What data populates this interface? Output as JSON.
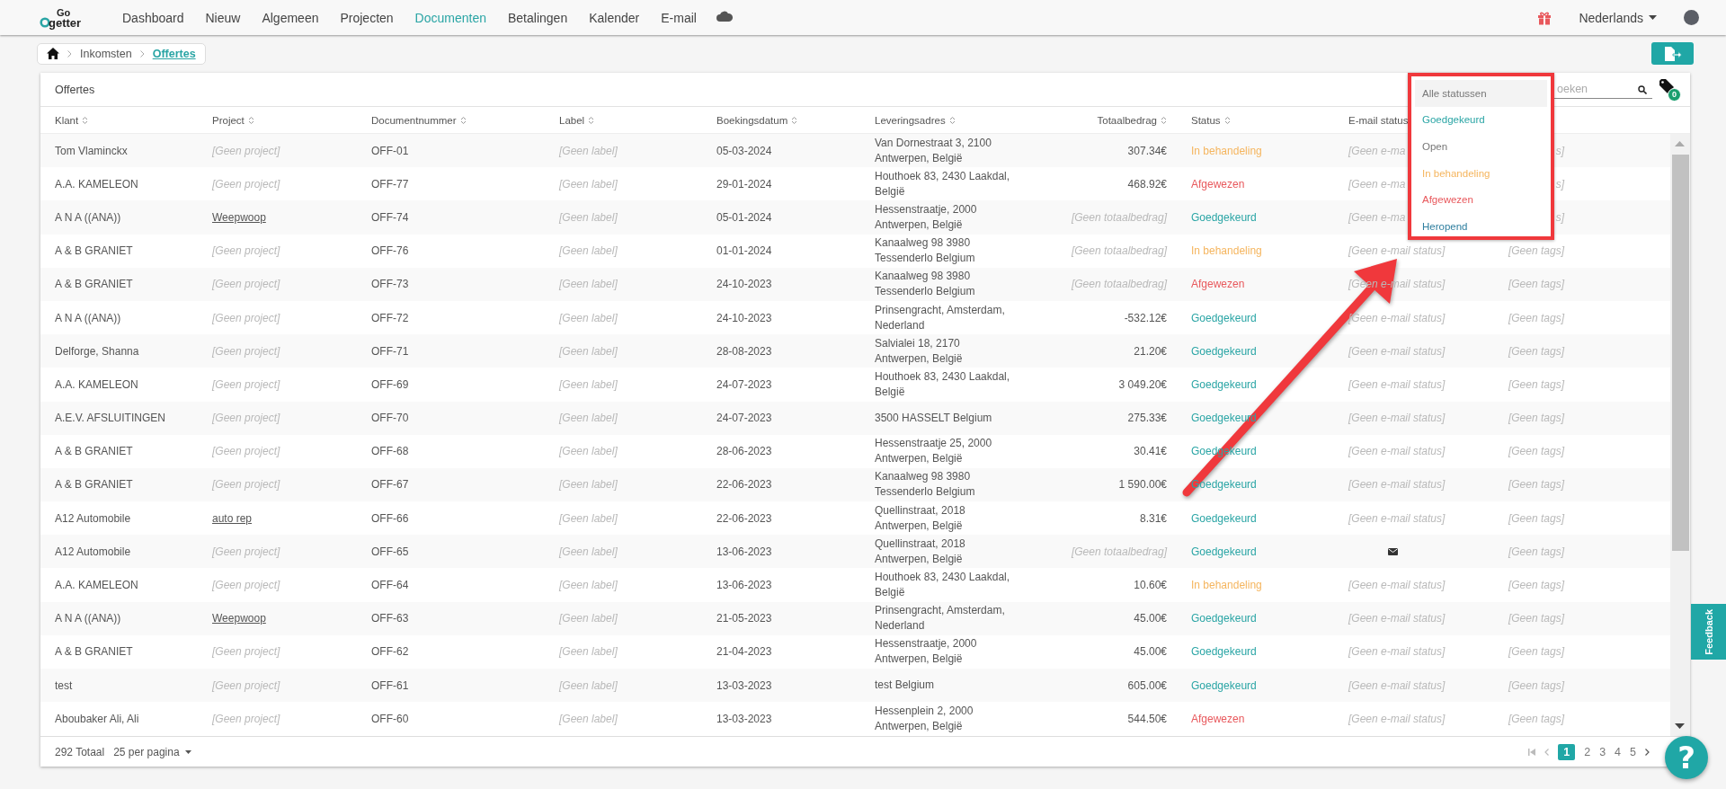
{
  "nav": {
    "logo": {
      "line_1": "Go",
      "line_2": "getter"
    },
    "items": [
      {
        "label": "Dashboard",
        "selected": false
      },
      {
        "label": "Nieuw",
        "selected": false
      },
      {
        "label": "Algemeen",
        "selected": false
      },
      {
        "label": "Projecten",
        "selected": false
      },
      {
        "label": "Documenten",
        "selected": true
      },
      {
        "label": "Betalingen",
        "selected": false
      },
      {
        "label": "Kalender",
        "selected": false
      },
      {
        "label": "E-mail",
        "selected": false
      }
    ],
    "language": "Nederlands"
  },
  "breadcrumb": [
    {
      "label": "Inkomsten",
      "selected": false
    },
    {
      "label": "Offertes",
      "selected": true
    }
  ],
  "card": {
    "title": "Offertes",
    "search": {
      "placeholder": "oeken"
    },
    "tag_count": "0"
  },
  "table": {
    "columns": [
      "Klant",
      "Project",
      "Documentnummer",
      "Label",
      "Boekingsdatum",
      "Leveringsadres",
      "Totaalbedrag",
      "Status",
      "E-mail status"
    ],
    "rows": [
      {
        "client": "Tom Vlaminckx",
        "project": {
          "text": "[Geen project]",
          "kind": "placeholder"
        },
        "number": "OFF-01",
        "label": {
          "text": "[Geen label]",
          "kind": "placeholder"
        },
        "date": "05-03-2024",
        "address": "Van Dornestraat 3, 2100\nAntwerpen, België",
        "amount": {
          "text": "307.34€",
          "kind": "value"
        },
        "status": {
          "text": "In behandeling",
          "color": "#f5b55e"
        },
        "email_status": {
          "text": "[Geen e-ma",
          "kind": "placeholder"
        },
        "tags": {
          "text": "s]",
          "kind": "placeholder"
        }
      },
      {
        "client": "A.A. KAMELEON",
        "project": {
          "text": "[Geen project]",
          "kind": "placeholder"
        },
        "number": "OFF-77",
        "label": {
          "text": "[Geen label]",
          "kind": "placeholder"
        },
        "date": "29-01-2024",
        "address": "Houthoek 83, 2430 Laakdal,\nBelgië",
        "amount": {
          "text": "468.92€",
          "kind": "value"
        },
        "status": {
          "text": "Afgewezen",
          "color": "#e8585c"
        },
        "email_status": {
          "text": "[Geen e-ma",
          "kind": "placeholder"
        },
        "tags": {
          "text": "s]",
          "kind": "placeholder"
        }
      },
      {
        "client": "A N A ((ANA))",
        "project": {
          "text": "Weepwoop",
          "kind": "link"
        },
        "number": "OFF-74",
        "label": {
          "text": "[Geen label]",
          "kind": "placeholder"
        },
        "date": "05-01-2024",
        "address": "Hessenstraatje, 2000\nAntwerpen, België",
        "amount": {
          "text": "[Geen totaalbedrag]",
          "kind": "placeholder"
        },
        "status": {
          "text": "Goedgekeurd",
          "color": "#2aa5a5"
        },
        "email_status": {
          "text": "[Geen e-ma",
          "kind": "placeholder"
        },
        "tags": {
          "text": "s]",
          "kind": "placeholder"
        }
      },
      {
        "client": "A & B GRANIET",
        "project": {
          "text": "[Geen project]",
          "kind": "placeholder"
        },
        "number": "OFF-76",
        "label": {
          "text": "[Geen label]",
          "kind": "placeholder"
        },
        "date": "01-01-2024",
        "address": "Kanaalweg 98 3980\nTessenderlo Belgium",
        "amount": {
          "text": "[Geen totaalbedrag]",
          "kind": "placeholder"
        },
        "status": {
          "text": "In behandeling",
          "color": "#f5b55e"
        },
        "email_status": {
          "text": "[Geen e-mail status]",
          "kind": "placeholder"
        },
        "tags": {
          "text": "[Geen tags]",
          "kind": "placeholder"
        }
      },
      {
        "client": "A & B GRANIET",
        "project": {
          "text": "[Geen project]",
          "kind": "placeholder"
        },
        "number": "OFF-73",
        "label": {
          "text": "[Geen label]",
          "kind": "placeholder"
        },
        "date": "24-10-2023",
        "address": "Kanaalweg 98 3980\nTessenderlo Belgium",
        "amount": {
          "text": "[Geen totaalbedrag]",
          "kind": "placeholder"
        },
        "status": {
          "text": "Afgewezen",
          "color": "#e8585c"
        },
        "email_status": {
          "text": "[Geen e-mail status]",
          "kind": "placeholder"
        },
        "tags": {
          "text": "[Geen tags]",
          "kind": "placeholder"
        }
      },
      {
        "client": "A N A ((ANA))",
        "project": {
          "text": "[Geen project]",
          "kind": "placeholder"
        },
        "number": "OFF-72",
        "label": {
          "text": "[Geen label]",
          "kind": "placeholder"
        },
        "date": "24-10-2023",
        "address": "Prinsengracht, Amsterdam,\nNederland",
        "amount": {
          "text": "-532.12€",
          "kind": "value"
        },
        "status": {
          "text": "Goedgekeurd",
          "color": "#2aa5a5"
        },
        "email_status": {
          "text": "[Geen e-mail status]",
          "kind": "placeholder"
        },
        "tags": {
          "text": "[Geen tags]",
          "kind": "placeholder"
        }
      },
      {
        "client": "Delforge, Shanna",
        "project": {
          "text": "[Geen project]",
          "kind": "placeholder"
        },
        "number": "OFF-71",
        "label": {
          "text": "[Geen label]",
          "kind": "placeholder"
        },
        "date": "28-08-2023",
        "address": "Salvialei 18, 2170\nAntwerpen, België",
        "amount": {
          "text": "21.20€",
          "kind": "value"
        },
        "status": {
          "text": "Goedgekeurd",
          "color": "#2aa5a5"
        },
        "email_status": {
          "text": "[Geen e-mail status]",
          "kind": "placeholder"
        },
        "tags": {
          "text": "[Geen tags]",
          "kind": "placeholder"
        }
      },
      {
        "client": "A.A. KAMELEON",
        "project": {
          "text": "[Geen project]",
          "kind": "placeholder"
        },
        "number": "OFF-69",
        "label": {
          "text": "[Geen label]",
          "kind": "placeholder"
        },
        "date": "24-07-2023",
        "address": "Houthoek 83, 2430 Laakdal,\nBelgië",
        "amount": {
          "text": "3 049.20€",
          "kind": "value"
        },
        "status": {
          "text": "Goedgekeurd",
          "color": "#2aa5a5"
        },
        "email_status": {
          "text": "[Geen e-mail status]",
          "kind": "placeholder"
        },
        "tags": {
          "text": "[Geen tags]",
          "kind": "placeholder"
        }
      },
      {
        "client": "A.E.V. AFSLUITINGEN",
        "project": {
          "text": "[Geen project]",
          "kind": "placeholder"
        },
        "number": "OFF-70",
        "label": {
          "text": "[Geen label]",
          "kind": "placeholder"
        },
        "date": "24-07-2023",
        "address": "3500 HASSELT Belgium",
        "amount": {
          "text": "275.33€",
          "kind": "value"
        },
        "status": {
          "text": "Goedgekeurd",
          "color": "#2aa5a5"
        },
        "email_status": {
          "text": "[Geen e-mail status]",
          "kind": "placeholder"
        },
        "tags": {
          "text": "[Geen tags]",
          "kind": "placeholder"
        }
      },
      {
        "client": "A & B GRANIET",
        "project": {
          "text": "[Geen project]",
          "kind": "placeholder"
        },
        "number": "OFF-68",
        "label": {
          "text": "[Geen label]",
          "kind": "placeholder"
        },
        "date": "28-06-2023",
        "address": "Hessenstraatje 25, 2000\nAntwerpen, België",
        "amount": {
          "text": "30.41€",
          "kind": "value"
        },
        "status": {
          "text": "Goedgekeurd",
          "color": "#2aa5a5"
        },
        "email_status": {
          "text": "[Geen e-mail status]",
          "kind": "placeholder"
        },
        "tags": {
          "text": "[Geen tags]",
          "kind": "placeholder"
        }
      },
      {
        "client": "A & B GRANIET",
        "project": {
          "text": "[Geen project]",
          "kind": "placeholder"
        },
        "number": "OFF-67",
        "label": {
          "text": "[Geen label]",
          "kind": "placeholder"
        },
        "date": "22-06-2023",
        "address": "Kanaalweg 98 3980\nTessenderlo Belgium",
        "amount": {
          "text": "1 590.00€",
          "kind": "value"
        },
        "status": {
          "text": "Goedgekeurd",
          "color": "#2aa5a5"
        },
        "email_status": {
          "text": "[Geen e-mail status]",
          "kind": "placeholder"
        },
        "tags": {
          "text": "[Geen tags]",
          "kind": "placeholder"
        }
      },
      {
        "client": "A12 Automobile",
        "project": {
          "text": "auto rep",
          "kind": "link"
        },
        "number": "OFF-66",
        "label": {
          "text": "[Geen label]",
          "kind": "placeholder"
        },
        "date": "22-06-2023",
        "address": "Quellinstraat, 2018\nAntwerpen, België",
        "amount": {
          "text": "8.31€",
          "kind": "value"
        },
        "status": {
          "text": "Goedgekeurd",
          "color": "#2aa5a5"
        },
        "email_status": {
          "text": "[Geen e-mail status]",
          "kind": "placeholder"
        },
        "tags": {
          "text": "[Geen tags]",
          "kind": "placeholder"
        }
      },
      {
        "client": "A12 Automobile",
        "project": {
          "text": "[Geen project]",
          "kind": "placeholder"
        },
        "number": "OFF-65",
        "label": {
          "text": "[Geen label]",
          "kind": "placeholder"
        },
        "date": "13-06-2023",
        "address": "Quellinstraat, 2018\nAntwerpen, België",
        "amount": {
          "text": "[Geen totaalbedrag]",
          "kind": "placeholder"
        },
        "status": {
          "text": "Goedgekeurd",
          "color": "#2aa5a5"
        },
        "email_status": {
          "kind": "icon"
        },
        "tags": {
          "text": "[Geen tags]",
          "kind": "placeholder"
        }
      },
      {
        "client": "A.A. KAMELEON",
        "project": {
          "text": "[Geen project]",
          "kind": "placeholder"
        },
        "number": "OFF-64",
        "label": {
          "text": "[Geen label]",
          "kind": "placeholder"
        },
        "date": "13-06-2023",
        "address": "Houthoek 83, 2430 Laakdal,\nBelgië",
        "amount": {
          "text": "10.60€",
          "kind": "value"
        },
        "status": {
          "text": "In behandeling",
          "color": "#f5b55e"
        },
        "email_status": {
          "text": "[Geen e-mail status]",
          "kind": "placeholder"
        },
        "tags": {
          "text": "[Geen tags]",
          "kind": "placeholder"
        }
      },
      {
        "client": "A N A ((ANA))",
        "project": {
          "text": "Weepwoop",
          "kind": "link"
        },
        "number": "OFF-63",
        "label": {
          "text": "[Geen label]",
          "kind": "placeholder"
        },
        "date": "21-05-2023",
        "address": "Prinsengracht, Amsterdam,\nNederland",
        "amount": {
          "text": "45.00€",
          "kind": "value"
        },
        "status": {
          "text": "Goedgekeurd",
          "color": "#2aa5a5"
        },
        "email_status": {
          "text": "[Geen e-mail status]",
          "kind": "placeholder"
        },
        "tags": {
          "text": "[Geen tags]",
          "kind": "placeholder"
        }
      },
      {
        "client": "A & B GRANIET",
        "project": {
          "text": "[Geen project]",
          "kind": "placeholder"
        },
        "number": "OFF-62",
        "label": {
          "text": "[Geen label]",
          "kind": "placeholder"
        },
        "date": "21-04-2023",
        "address": "Hessenstraatje, 2000\nAntwerpen, België",
        "amount": {
          "text": "45.00€",
          "kind": "value"
        },
        "status": {
          "text": "Goedgekeurd",
          "color": "#2aa5a5"
        },
        "email_status": {
          "text": "[Geen e-mail status]",
          "kind": "placeholder"
        },
        "tags": {
          "text": "[Geen tags]",
          "kind": "placeholder"
        }
      },
      {
        "client": "test",
        "project": {
          "text": "[Geen project]",
          "kind": "placeholder"
        },
        "number": "OFF-61",
        "label": {
          "text": "[Geen label]",
          "kind": "placeholder"
        },
        "date": "13-03-2023",
        "address": "test Belgium",
        "amount": {
          "text": "605.00€",
          "kind": "value"
        },
        "status": {
          "text": "Goedgekeurd",
          "color": "#2aa5a5"
        },
        "email_status": {
          "text": "[Geen e-mail status]",
          "kind": "placeholder"
        },
        "tags": {
          "text": "[Geen tags]",
          "kind": "placeholder"
        }
      },
      {
        "client": "Aboubaker Ali, Ali",
        "project": {
          "text": "[Geen project]",
          "kind": "placeholder"
        },
        "number": "OFF-60",
        "label": {
          "text": "[Geen label]",
          "kind": "placeholder"
        },
        "date": "13-03-2023",
        "address": "Hessenplein 2, 2000\nAntwerpen, België",
        "amount": {
          "text": "544.50€",
          "kind": "value"
        },
        "status": {
          "text": "Afgewezen",
          "color": "#e8585c"
        },
        "email_status": {
          "text": "[Geen e-mail status]",
          "kind": "placeholder"
        },
        "tags": {
          "text": "[Geen tags]",
          "kind": "placeholder"
        }
      }
    ]
  },
  "status_menu": {
    "options": [
      {
        "label": "Alle statussen",
        "color": "#777777",
        "selected": true
      },
      {
        "label": "Goedgekeurd",
        "color": "#2aa5a5",
        "selected": false
      },
      {
        "label": "Open",
        "color": "#777777",
        "selected": false
      },
      {
        "label": "In behandeling",
        "color": "#f5b55e",
        "selected": false
      },
      {
        "label": "Afgewezen",
        "color": "#e8585c",
        "selected": false
      },
      {
        "label": "Heropend",
        "color": "#2f7f9f",
        "selected": false
      }
    ]
  },
  "footer": {
    "total": "292 Totaal",
    "per_page": "25 per pagina",
    "pages": [
      {
        "label": "1",
        "selected": true
      },
      {
        "label": "2",
        "selected": false
      },
      {
        "label": "3",
        "selected": false
      },
      {
        "label": "4",
        "selected": false
      },
      {
        "label": "5",
        "selected": false
      }
    ]
  },
  "feedback": "Feedback",
  "help": "?"
}
